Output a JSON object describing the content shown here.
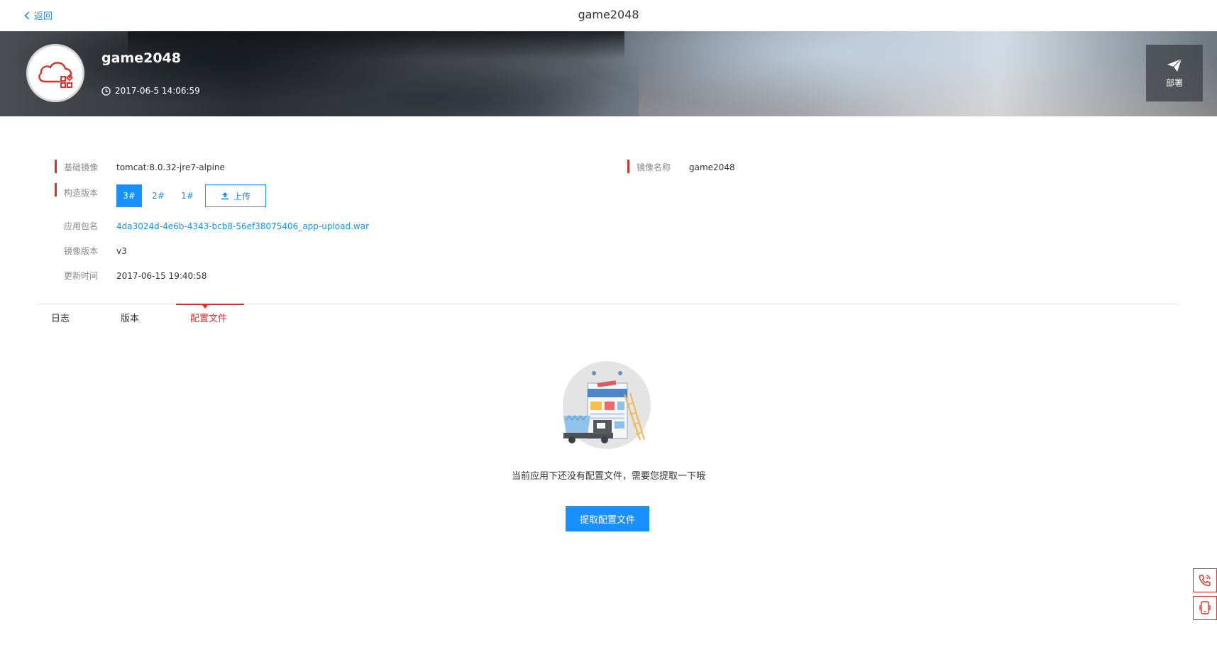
{
  "topbar": {
    "back_label": "返回",
    "title": "game2048"
  },
  "banner": {
    "app_name": "game2048",
    "created_time": "2017-06-5 14:06:59",
    "deploy_label": "部署"
  },
  "info": {
    "base_image": {
      "label": "基础镜像",
      "value": "tomcat:8.0.32-jre7-alpine"
    },
    "image_name": {
      "label": "镜像名称",
      "value": "game2048"
    },
    "build_version": {
      "label": "构造版本",
      "versions": [
        "3#",
        "2#",
        "1#"
      ],
      "active": "3#",
      "upload_label": "上传"
    },
    "package_name": {
      "label": "应用包名",
      "value": "4da3024d-4e6b-4343-bcb8-56ef38075406_app-upload.war"
    },
    "image_version": {
      "label": "镜像版本",
      "value": "v3"
    },
    "update_time": {
      "label": "更新时间",
      "value": "2017-06-15 19:40:58"
    }
  },
  "tabs": [
    {
      "label": "日志"
    },
    {
      "label": "版本"
    },
    {
      "label": "配置文件"
    }
  ],
  "active_tab": "配置文件",
  "empty_state": {
    "message": "当前应用下还没有配置文件，需要您提取一下哦",
    "button_label": "提取配置文件"
  },
  "colors": {
    "primary": "#1890ff",
    "accent_red": "#e0302a"
  },
  "side_widgets": [
    "phone-icon",
    "mobile-icon"
  ]
}
